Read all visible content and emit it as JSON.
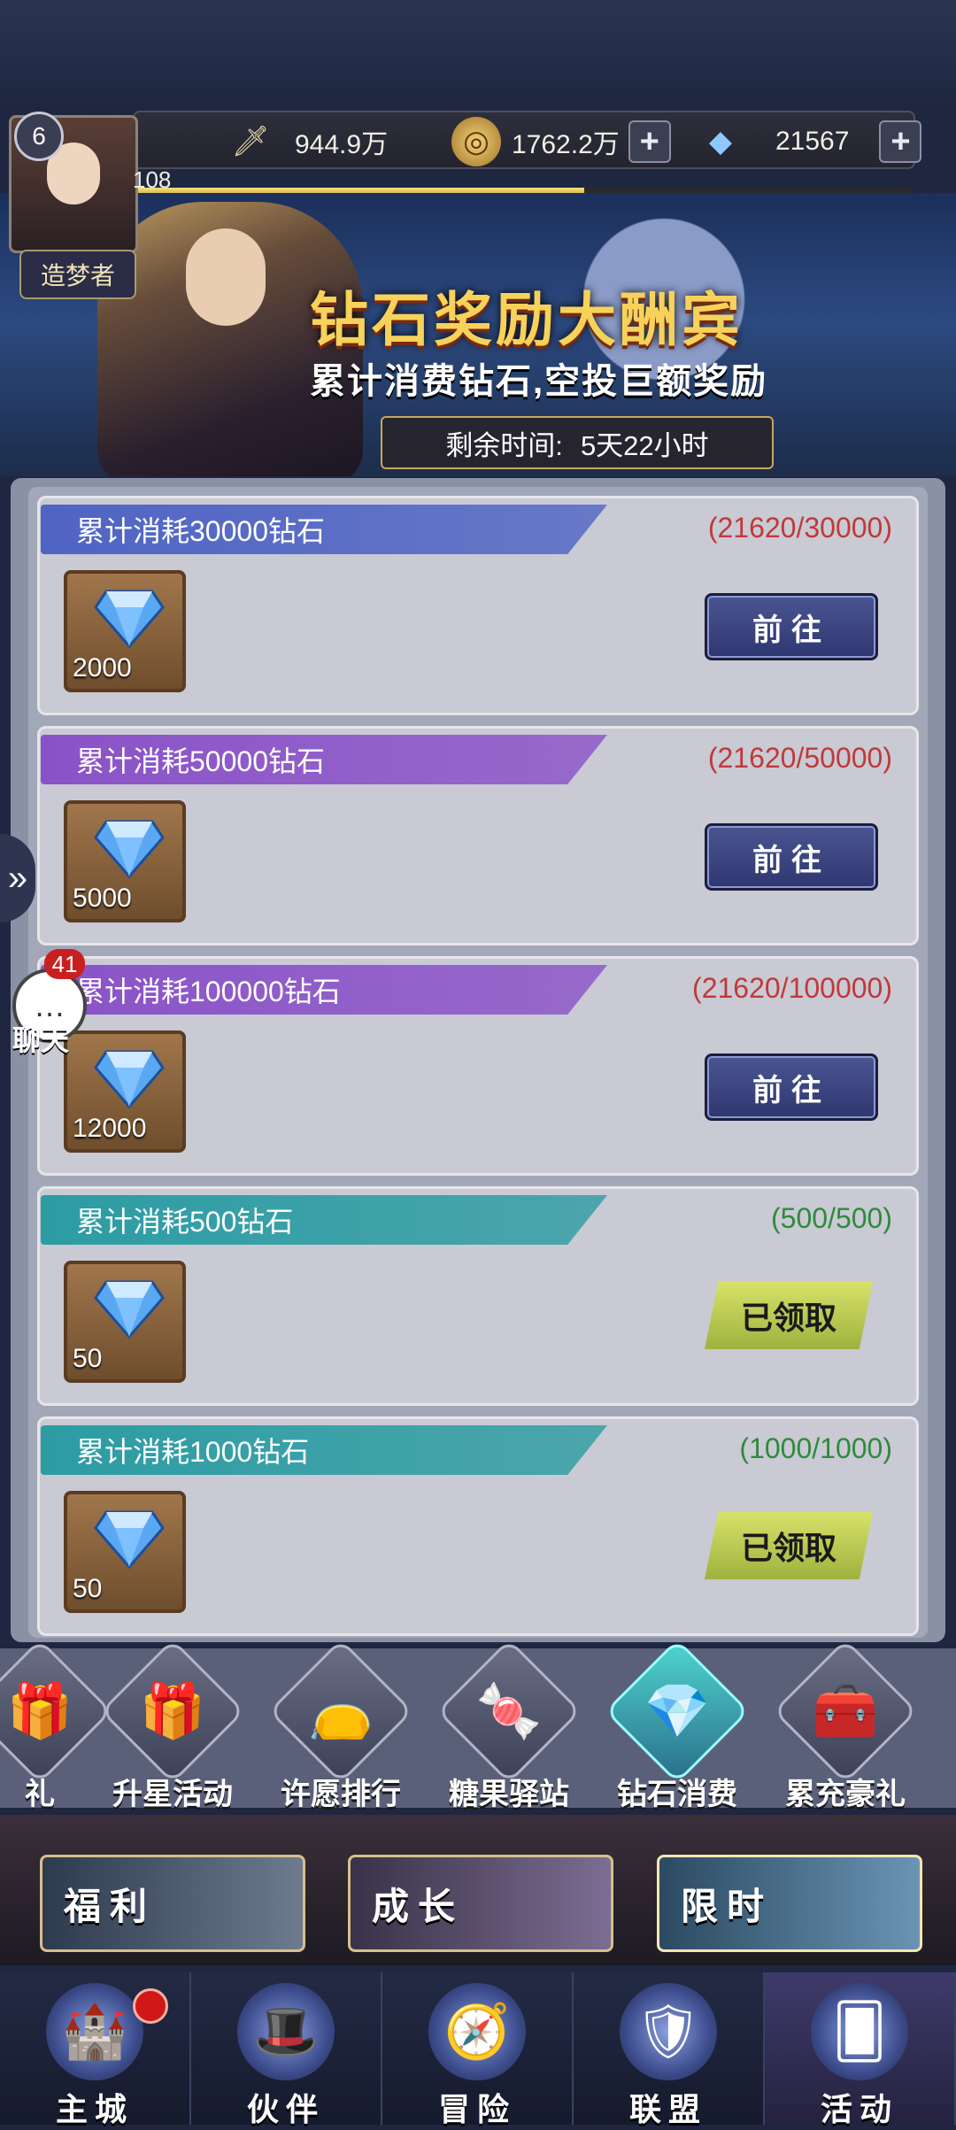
{
  "status": {
    "level": "6",
    "xp": "108",
    "xp_progress": 0.58,
    "title_badge": "造梦者",
    "power": "944.9万",
    "gold": "1762.2万",
    "diamonds": "21567"
  },
  "banner": {
    "title": "钻石奖励大酬宾",
    "subtitle": "累计消费钻石,空投巨额奖励",
    "timer_label": "剩余时间:",
    "timer_value": "5天22小时"
  },
  "tasks": [
    {
      "label": "累计消耗30000钻石",
      "progress": "(21620/30000)",
      "reward_qty": "2000",
      "action": "前往",
      "claimed": false,
      "header_color": "#4f64c4",
      "progress_color": "#c0393b"
    },
    {
      "label": "累计消耗50000钻石",
      "progress": "(21620/50000)",
      "reward_qty": "5000",
      "action": "前往",
      "claimed": false,
      "header_color": "#8a52c8",
      "progress_color": "#c0393b"
    },
    {
      "label": "累计消耗100000钻石",
      "progress": "(21620/100000)",
      "reward_qty": "12000",
      "action": "前往",
      "claimed": false,
      "header_color": "#8a52c8",
      "progress_color": "#c0393b"
    },
    {
      "label": "累计消耗500钻石",
      "progress": "(500/500)",
      "reward_qty": "50",
      "action": "已领取",
      "claimed": true,
      "header_color": "#2c9ca3",
      "progress_color": "#2f8a3e"
    },
    {
      "label": "累计消耗1000钻石",
      "progress": "(1000/1000)",
      "reward_qty": "50",
      "action": "已领取",
      "claimed": true,
      "header_color": "#2c9ca3",
      "progress_color": "#2f8a3e"
    }
  ],
  "chat": {
    "count": "41",
    "label": "聊天"
  },
  "categories": [
    {
      "label": "礼",
      "icon": "gift-icon"
    },
    {
      "label": "升星活动",
      "icon": "star-gift-icon"
    },
    {
      "label": "许愿排行",
      "icon": "wish-bag-icon"
    },
    {
      "label": "糖果驿站",
      "icon": "candy-icon"
    },
    {
      "label": "钻石消费",
      "icon": "diamond-pile-icon"
    },
    {
      "label": "累充豪礼",
      "icon": "treasure-chest-icon"
    }
  ],
  "active_category": "钻石消费",
  "subtabs": [
    {
      "label": "福利"
    },
    {
      "label": "成长"
    },
    {
      "label": "限时"
    }
  ],
  "nav": [
    {
      "label": "主城",
      "icon": "castle-icon",
      "badge": true
    },
    {
      "label": "伙伴",
      "icon": "witch-hat-icon",
      "badge": false
    },
    {
      "label": "冒险",
      "icon": "compass-icon",
      "badge": false
    },
    {
      "label": "联盟",
      "icon": "shield-icon",
      "badge": false
    },
    {
      "label": "活动",
      "icon": "cards-icon",
      "badge": false
    }
  ],
  "active_nav": "活动"
}
